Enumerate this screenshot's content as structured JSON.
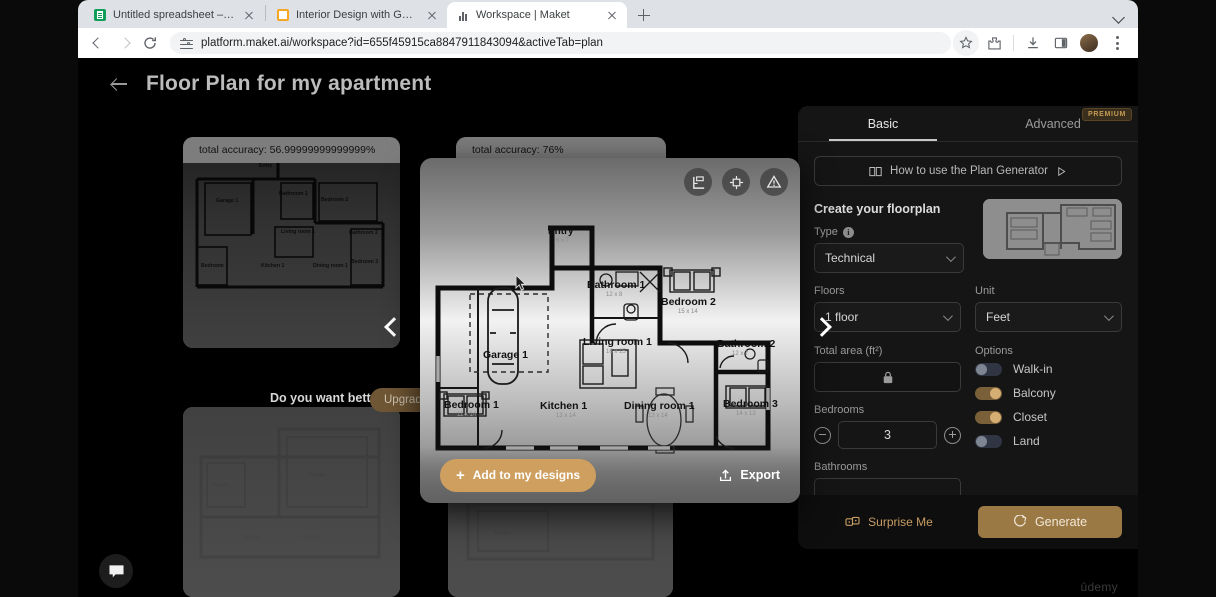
{
  "browser": {
    "tabs": [
      {
        "title": "Untitled spreadsheet – Googl",
        "favicon": "sheets-icon",
        "active": false
      },
      {
        "title": "Interior Design with Generati",
        "favicon": "orange-square-icon",
        "active": false
      },
      {
        "title": "Workspace | Maket",
        "favicon": "maket-icon",
        "active": true
      }
    ],
    "new_tab_label": "+",
    "url": "platform.maket.ai/workspace?id=655f45915ca8847911843094&activeTab=plan",
    "toolbar_icons": [
      "bookmark-star-icon",
      "extensions-icon",
      "downloads-icon",
      "side-panel-icon",
      "profile-avatar",
      "chrome-menu-icon"
    ]
  },
  "page": {
    "title": "Floor Plan for my apartment",
    "back_label": "back-arrow"
  },
  "cards": [
    {
      "accuracy": "total accuracy: 56.99999999999999%"
    },
    {
      "accuracy": "total accuracy: 76%"
    }
  ],
  "promo": {
    "text": "Do you want better design",
    "upgrade_label": "Upgrade"
  },
  "modal": {
    "tools": [
      "measure-icon",
      "crop-frame-icon",
      "warning-triangle-icon"
    ],
    "add_label": "Add to my designs",
    "add_plus": "+",
    "export_label": "Export"
  },
  "floorplan": {
    "rooms": [
      {
        "name": "Entry",
        "dims": "6 x 7"
      },
      {
        "name": "Garage 1",
        "dims": ""
      },
      {
        "name": "Bathroom 1",
        "dims": "12 x 8"
      },
      {
        "name": "Bedroom 2",
        "dims": "15 x 14"
      },
      {
        "name": "Living room 1",
        "dims": "16 x 15"
      },
      {
        "name": "Bedroom 1",
        "dims": "11 x 14"
      },
      {
        "name": "Kitchen 1",
        "dims": "13 x 14"
      },
      {
        "name": "Dining room 1",
        "dims": "13 x 14"
      },
      {
        "name": "Bedroom 3",
        "dims": "14 x 13"
      },
      {
        "name": "Bathroom 2",
        "dims": "12 x 7"
      }
    ]
  },
  "panel": {
    "tabs": [
      {
        "label": "Basic",
        "active": true
      },
      {
        "label": "Advanced",
        "active": false,
        "badge": "PREMIUM"
      }
    ],
    "howto": "How to use the Plan Generator",
    "section_title": "Create your floorplan",
    "type": {
      "label": "Type",
      "value": "Technical"
    },
    "floors": {
      "label": "Floors",
      "value": "1 floor"
    },
    "unit": {
      "label": "Unit",
      "value": "Feet"
    },
    "total_area": {
      "label": "Total area (ft²)",
      "value": "",
      "locked": true
    },
    "bedrooms": {
      "label": "Bedrooms",
      "value": "3"
    },
    "bathrooms": {
      "label": "Bathrooms"
    },
    "options_label": "Options",
    "options": [
      {
        "label": "Walk-in",
        "on": false
      },
      {
        "label": "Balcony",
        "on": true
      },
      {
        "label": "Closet",
        "on": true
      },
      {
        "label": "Land",
        "on": false
      }
    ],
    "surprise_label": "Surprise Me",
    "generate_label": "Generate"
  },
  "footer": {
    "chat_icon": "chat-bubble-icon",
    "watermark": "ûdemy"
  },
  "colors": {
    "accent": "#cf9f5f",
    "generate": "#9b7944",
    "toggle_on": "#7a6038",
    "panel_bg": "#151515"
  }
}
